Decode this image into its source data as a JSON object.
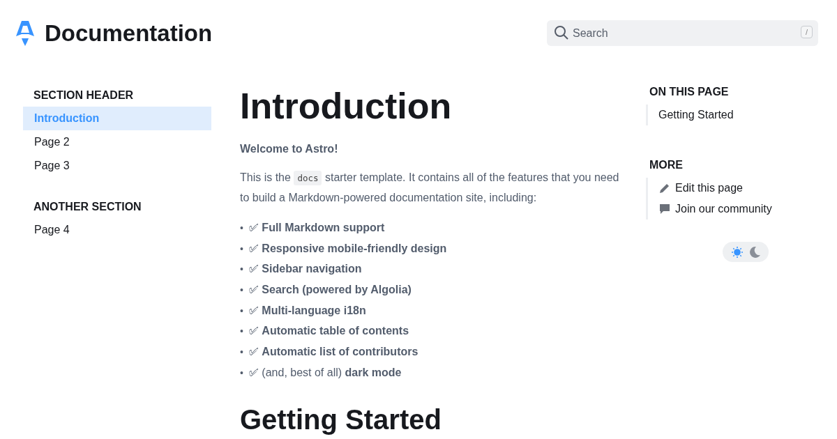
{
  "header": {
    "title": "Documentation",
    "search": {
      "placeholder": "Search",
      "shortcut": "/"
    }
  },
  "sidebar": {
    "sections": [
      {
        "header": "SECTION HEADER",
        "items": [
          {
            "label": "Introduction",
            "selected": true
          },
          {
            "label": "Page 2",
            "selected": false
          },
          {
            "label": "Page 3",
            "selected": false
          }
        ]
      },
      {
        "header": "ANOTHER SECTION",
        "items": [
          {
            "label": "Page 4",
            "selected": false
          }
        ]
      }
    ]
  },
  "article": {
    "title": "Introduction",
    "lead": "Welcome to Astro!",
    "intro_before": "This is the",
    "intro_code": "docs",
    "intro_after": "starter template. It contains all of the features that you need to build a Markdown-powered documentation site, including:",
    "features": [
      {
        "bullet": "•",
        "text": "✅ **Full Markdown support**"
      },
      {
        "bullet": "•",
        "text": "✅ **Responsive mobile-friendly design**"
      },
      {
        "bullet": "•",
        "text": "✅ **Sidebar navigation**"
      },
      {
        "bullet": "•",
        "text": "✅ **Search (powered by Algolia)**"
      },
      {
        "bullet": "•",
        "text": "✅ **Multi-language i18n**"
      },
      {
        "bullet": "•",
        "text": "✅ **Automatic table of contents**"
      },
      {
        "bullet": "•",
        "text": "✅ **Automatic list of contributors**"
      },
      {
        "bullet": "•",
        "text": "✅ (and, best of all) **dark mode**"
      }
    ],
    "subheading": "Getting Started"
  },
  "toc": {
    "heading": "ON THIS PAGE",
    "items": [
      "Getting Started"
    ]
  },
  "more": {
    "heading": "MORE",
    "links": [
      {
        "kind": "edit",
        "label": "Edit this page"
      },
      {
        "kind": "community",
        "label": "Join our community"
      }
    ]
  },
  "theme_toggle": [
    {
      "kind": "light",
      "selected": true
    },
    {
      "kind": "dark",
      "selected": false
    }
  ]
}
